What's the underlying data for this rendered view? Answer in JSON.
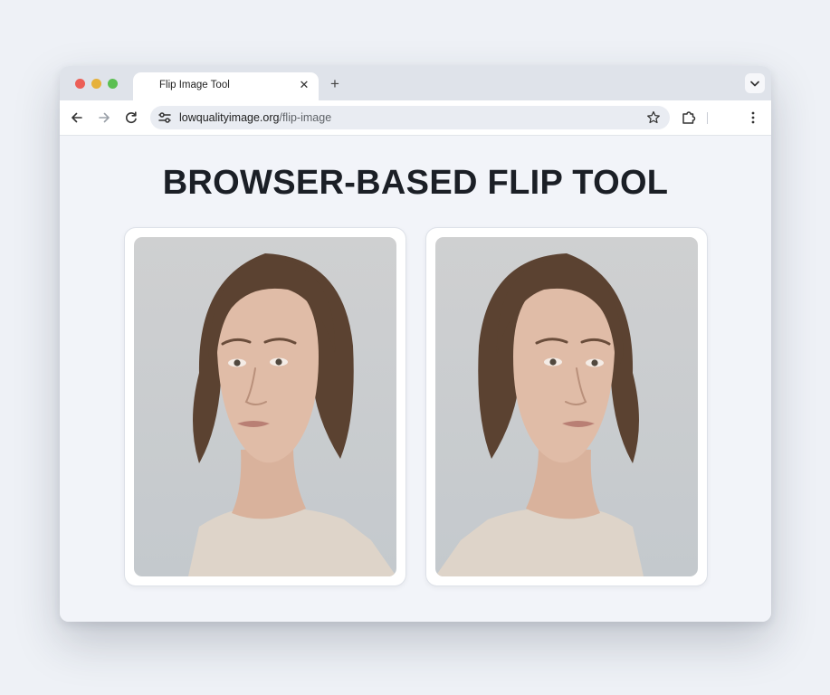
{
  "browser": {
    "tab": {
      "title": "Flip Image Tool",
      "close_glyph": "✕"
    },
    "new_tab_glyph": "+",
    "address": {
      "domain": "lowqualityimage.org",
      "path": "/flip-image"
    },
    "icons": {
      "back": "arrow-left-icon",
      "forward": "arrow-right-icon",
      "reload": "reload-icon",
      "site_settings": "tune-icon",
      "bookmark": "star-icon",
      "extensions": "puzzle-icon",
      "menu": "kebab-icon",
      "tab_search": "chevron-down-icon"
    },
    "colors": {
      "close": "#ec5f57",
      "minimize": "#e6b13b",
      "maximize": "#5bbf52"
    }
  },
  "page": {
    "headline": "BROWSER-BASED FLIP TOOL",
    "images": [
      {
        "label": "original-portrait"
      },
      {
        "label": "flipped-portrait"
      }
    ]
  }
}
